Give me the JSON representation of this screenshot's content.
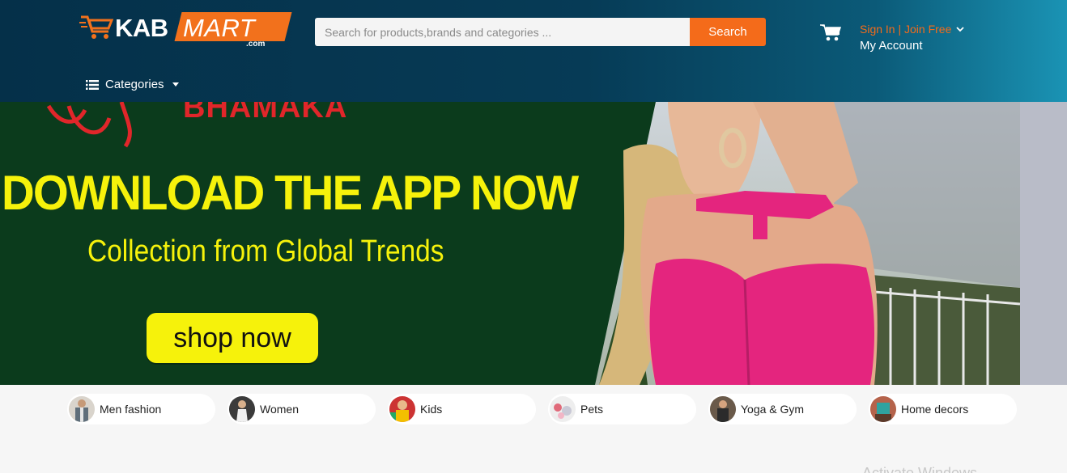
{
  "header": {
    "logo": {
      "kab": "KAB",
      "mart": "MART",
      "com": ".com"
    },
    "search": {
      "placeholder": "Search for products,brands and categories ...",
      "button_label": "Search"
    },
    "account": {
      "signin_label": "Sign In | Join Free",
      "my_account_label": "My Account"
    },
    "categories_label": "Categories"
  },
  "banner": {
    "top_text": "BHAMAKA",
    "headline": "DOWNLOAD THE APP NOW",
    "subheadline": "Collection from Global Trends",
    "cta_label": "shop now"
  },
  "category_pills": [
    {
      "label": "Men fashion",
      "icon": "men-fashion-thumb"
    },
    {
      "label": "Women",
      "icon": "women-thumb"
    },
    {
      "label": "Kids",
      "icon": "kids-thumb"
    },
    {
      "label": "Pets",
      "icon": "pets-thumb"
    },
    {
      "label": "Yoga & Gym",
      "icon": "yoga-gym-thumb"
    },
    {
      "label": "Home decors",
      "icon": "home-decors-thumb"
    }
  ],
  "overlay_text": "Activate Windows",
  "colors": {
    "accent": "#f46b1a",
    "header_dark": "#053049",
    "banner_green": "#0b3b1c",
    "banner_yellow": "#f6f20b",
    "pink": "#e4257e"
  }
}
